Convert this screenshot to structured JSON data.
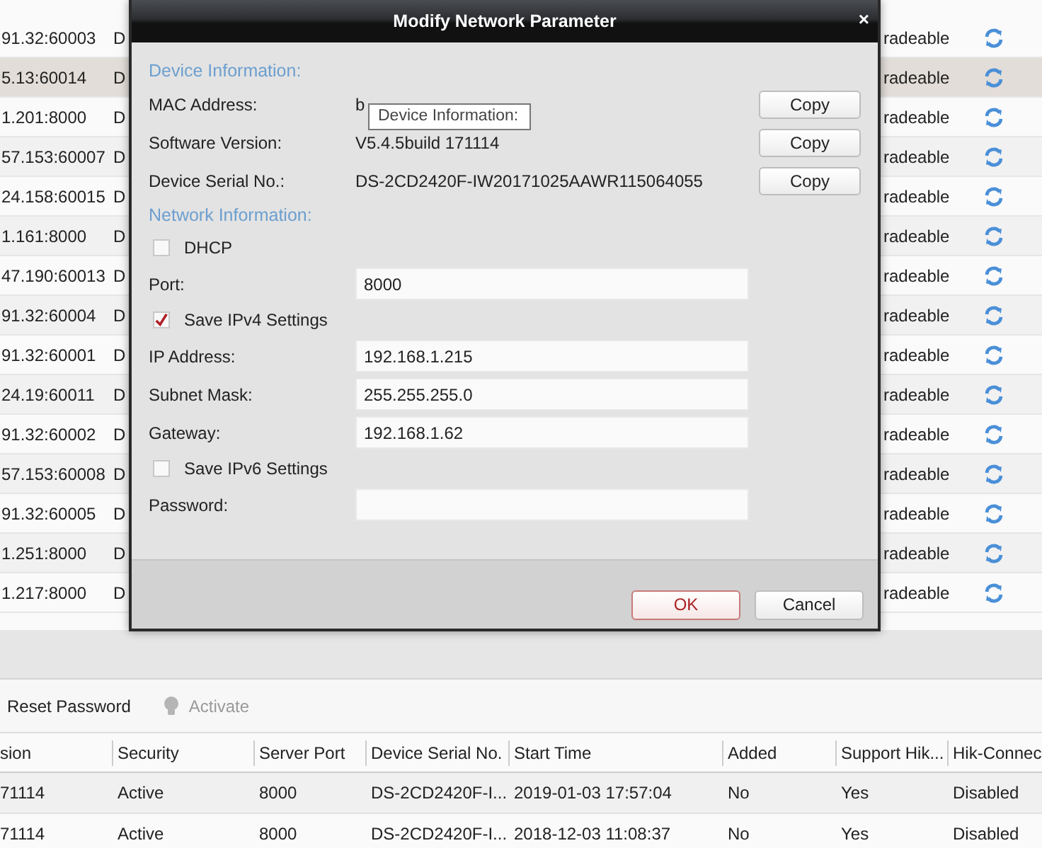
{
  "device_list": {
    "rows": [
      {
        "address": "91.32:60003",
        "model": "D",
        "status": "radeable",
        "selected": false
      },
      {
        "address": "5.13:60014",
        "model": "D",
        "status": "radeable",
        "selected": true
      },
      {
        "address": "1.201:8000",
        "model": "D",
        "status": "radeable",
        "selected": false
      },
      {
        "address": "57.153:60007",
        "model": "D",
        "status": "radeable",
        "selected": false
      },
      {
        "address": "24.158:60015",
        "model": "D",
        "status": "radeable",
        "selected": false
      },
      {
        "address": "1.161:8000",
        "model": "D",
        "status": "radeable",
        "selected": false
      },
      {
        "address": "47.190:60013",
        "model": "D",
        "status": "radeable",
        "selected": false
      },
      {
        "address": "91.32:60004",
        "model": "D",
        "status": "radeable",
        "selected": false
      },
      {
        "address": "91.32:60001",
        "model": "D",
        "status": "radeable",
        "selected": false
      },
      {
        "address": "24.19:60011",
        "model": "D",
        "status": "radeable",
        "selected": false
      },
      {
        "address": "91.32:60002",
        "model": "D",
        "status": "radeable",
        "selected": false
      },
      {
        "address": "57.153:60008",
        "model": "D",
        "status": "radeable",
        "selected": false
      },
      {
        "address": "91.32:60005",
        "model": "D",
        "status": "radeable",
        "selected": false
      },
      {
        "address": "1.251:8000",
        "model": "D",
        "status": "radeable",
        "selected": false
      },
      {
        "address": "1.217:8000",
        "model": "D",
        "status": "radeable",
        "selected": false
      }
    ]
  },
  "toolbar": {
    "buttons": [
      {
        "label": "Reset Password",
        "kind": "plain",
        "disabled": false
      },
      {
        "label": "Activate",
        "kind": "with-icon",
        "disabled": true
      }
    ]
  },
  "table": {
    "columns": [
      "sion",
      "Security",
      "Server Port",
      "Device Serial No.",
      "Start Time",
      "Added",
      "Support Hik...",
      "Hik-Connec"
    ],
    "rows": [
      [
        "71114",
        "Active",
        "8000",
        "DS-2CD2420F-I...",
        "2019-01-03 17:57:04",
        "No",
        "Yes",
        "Disabled"
      ],
      [
        "71114",
        "Active",
        "8000",
        "DS-2CD2420F-I...",
        "2018-12-03 11:08:37",
        "No",
        "Yes",
        "Disabled"
      ]
    ]
  },
  "dialog": {
    "title": "Modify Network Parameter",
    "close": "×",
    "items": [
      {
        "kind": "heading",
        "text": "Device Information:"
      },
      {
        "kind": "info",
        "label": "MAC Address:",
        "value": "b",
        "button": "Copy"
      },
      {
        "kind": "info",
        "label": "Software Version:",
        "value": "V5.4.5build 171114",
        "button": "Copy"
      },
      {
        "kind": "info",
        "label": "Device Serial No.:",
        "value": "DS-2CD2420F-IW20171025AAWR115064055",
        "button": "Copy"
      },
      {
        "kind": "heading",
        "text": "Network Information:"
      },
      {
        "kind": "checkbox",
        "label": "DHCP",
        "checked": false
      },
      {
        "kind": "field",
        "label": "Port:",
        "value": "8000"
      },
      {
        "kind": "checkbox",
        "label": "Save IPv4 Settings",
        "checked": true
      },
      {
        "kind": "field",
        "label": "IP Address:",
        "value": "192.168.1.215"
      },
      {
        "kind": "field",
        "label": "Subnet Mask:",
        "value": "255.255.255.0"
      },
      {
        "kind": "field",
        "label": "Gateway:",
        "value": "192.168.1.62"
      },
      {
        "kind": "checkbox",
        "label": "Save IPv6 Settings",
        "checked": false
      },
      {
        "kind": "field",
        "label": "Password:"
      }
    ],
    "tooltip": "Device Information:",
    "buttons": [
      {
        "label": "OK",
        "kind": "primary"
      },
      {
        "label": "Cancel",
        "kind": "secondary"
      }
    ]
  }
}
